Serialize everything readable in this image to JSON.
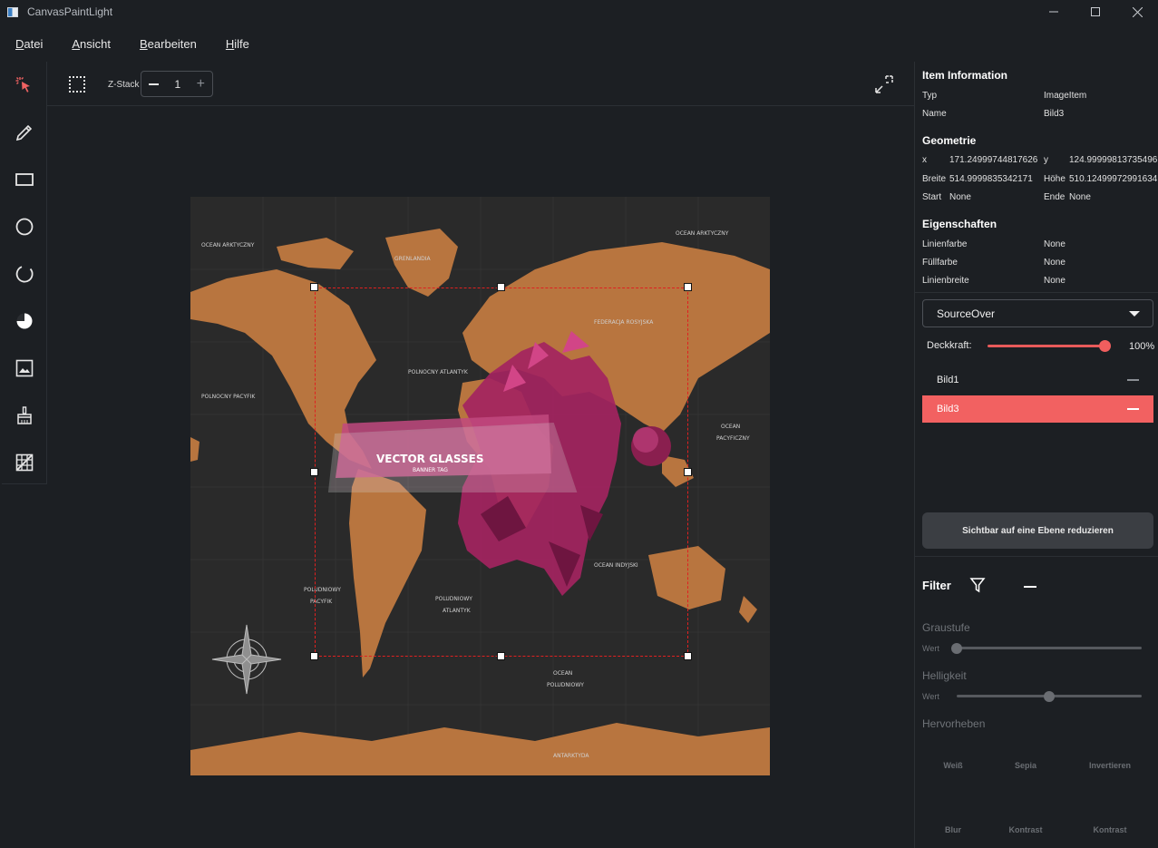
{
  "window": {
    "title": "CanvasPaintLight"
  },
  "menu": [
    "Datei",
    "Ansicht",
    "Bearbeiten",
    "Hilfe"
  ],
  "tools": [
    "select-pointer-icon",
    "pencil-icon",
    "rectangle-icon",
    "circle-icon",
    "arc-icon",
    "pie-icon",
    "image-icon",
    "brush-icon",
    "grid-erase-icon"
  ],
  "canvas_toolbar": {
    "zstack_label": "Z-Stack",
    "zstack_value": "1"
  },
  "item_info": {
    "title": "Item Information",
    "typ_label": "Typ",
    "typ_value": "ImageItem",
    "name_label": "Name",
    "name_value": "Bild3"
  },
  "geometrie": {
    "title": "Geometrie",
    "x_label": "x",
    "x_value": "171.24999744817626",
    "y_label": "y",
    "y_value": "124.99999813735496",
    "breite_label": "Breite",
    "breite_value": "514.9999835342171",
    "hoehe_label": "Höhe",
    "hoehe_value": "510.12499972991634",
    "start_label": "Start",
    "start_value": "None",
    "ende_label": "Ende",
    "ende_value": "None"
  },
  "eigenschaften": {
    "title": "Eigenschaften",
    "linienfarbe_label": "Linienfarbe",
    "linienfarbe_value": "None",
    "fuellfarbe_label": "Füllfarbe",
    "fuellfarbe_value": "None",
    "linienbreite_label": "Linienbreite",
    "linienbreite_value": "None"
  },
  "blend": {
    "mode": "SourceOver",
    "opacity_label": "Deckkraft:",
    "opacity_value": "100%",
    "opacity_fraction": 1.0
  },
  "layers": [
    {
      "name": "Bild1",
      "active": false
    },
    {
      "name": "Bild3",
      "active": true
    }
  ],
  "flatten_label": "Sichtbar auf eine Ebene reduzieren",
  "filter": {
    "title": "Filter",
    "graustufe": "Graustufe",
    "graustufe_wert": "Wert",
    "graustufe_level": 0.0,
    "helligkeit": "Helligkeit",
    "helligkeit_wert": "Wert",
    "helligkeit_level": 0.5,
    "hervorheben": "Hervorheben",
    "buttons_row1": [
      "Weiß",
      "Sepia",
      "Invertieren"
    ],
    "buttons_row2": [
      "Blur",
      "Kontrast",
      "Kontrast"
    ]
  },
  "canvas_image": {
    "banner_title": "VECTOR GLASSES",
    "banner_sub": "BANNER TAG",
    "map_labels": [
      "OCEAN ARKTYCZNY",
      "OCEAN ARKTYCZNY",
      "POLNOCNY PACYFIK",
      "POLNOCNY ATLANTYK",
      "FEDERACJA ROSYJSKA",
      "OCEAN PACYFICZNY",
      "POLUDNIOWY PACYFIK",
      "POLUDNIOWY ATLANTYK",
      "OCEAN POLUDNIOWY",
      "ANTARKTYDA",
      "OCEAN INDYJSKI",
      "GRENLANDIA"
    ]
  },
  "colors": {
    "accent": "#f26161",
    "background": "#1c1f23",
    "land": "#b8753f",
    "selection": "#e02020"
  }
}
